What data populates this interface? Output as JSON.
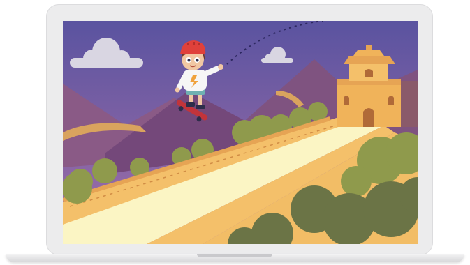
{
  "scene": {
    "subject": "skateboarder-kid",
    "setting": "great-wall",
    "colors": {
      "sky_top": "#5a53a0",
      "sky_bottom": "#9a6da6",
      "mountain": "#7c4f7f",
      "mountain_dark": "#6a4270",
      "wall": "#f4c06a",
      "wall_shadow": "#e6a454",
      "path": "#fbf5c4",
      "bush": "#8f9a4c",
      "bush_dark": "#6b7446",
      "helmet": "#e0413b",
      "tower": "#f0b35a"
    }
  }
}
